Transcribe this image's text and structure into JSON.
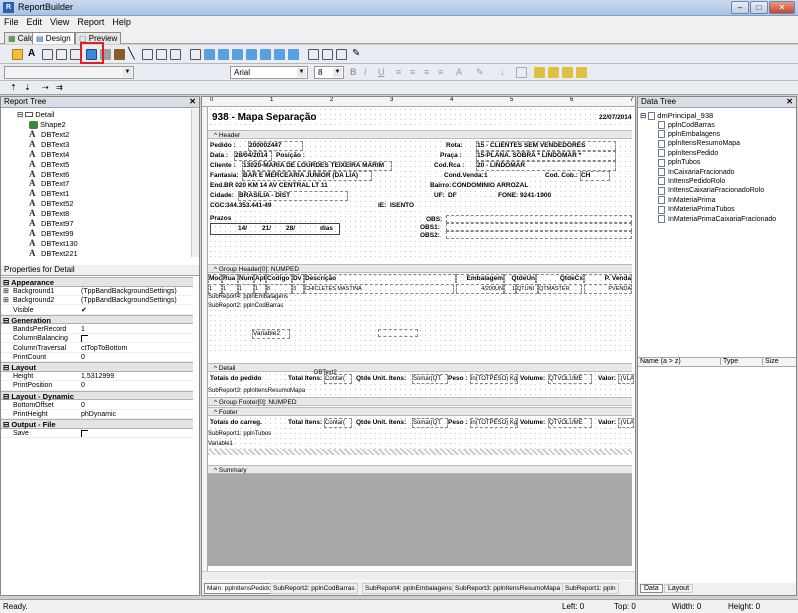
{
  "app": {
    "title": "ReportBuilder"
  },
  "menu": [
    "File",
    "Edit",
    "View",
    "Report",
    "Help"
  ],
  "top_tabs": [
    "Calc",
    "Design",
    "Preview"
  ],
  "font": {
    "name": "Arial",
    "size": "8"
  },
  "report_tree": {
    "title": "Report Tree",
    "root": "Detail",
    "items": [
      "Shape2",
      "DBText2",
      "DBText3",
      "DBText4",
      "DBText5",
      "DBText6",
      "DBText7",
      "DBText1",
      "DBText52",
      "DBText8",
      "DBText97",
      "DBText99",
      "DBText130",
      "DBText221"
    ]
  },
  "properties": {
    "title": "Properties for Detail",
    "sections": [
      {
        "name": "Appearance",
        "rows": [
          {
            "k": "Background1",
            "v": "(TppBandBackgroundSettings)",
            "plus": true
          },
          {
            "k": "Background2",
            "v": "(TppBandBackgroundSettings)",
            "plus": true
          },
          {
            "k": "Visible",
            "v": "",
            "check": true
          }
        ]
      },
      {
        "name": "Generation",
        "rows": [
          {
            "k": "BandsPerRecord",
            "v": "1"
          },
          {
            "k": "ColumnBalancing",
            "v": "",
            "check": false
          },
          {
            "k": "ColumnTraversal",
            "v": "ctTopToBottom"
          },
          {
            "k": "PrintCount",
            "v": "0"
          }
        ]
      },
      {
        "name": "Layout",
        "rows": [
          {
            "k": "Height",
            "v": "1,5312999"
          },
          {
            "k": "PrintPosition",
            "v": "0"
          }
        ]
      },
      {
        "name": "Layout - Dynamic",
        "rows": [
          {
            "k": "BottomOffset",
            "v": "0"
          },
          {
            "k": "PrintHeight",
            "v": "phDynamic"
          }
        ]
      },
      {
        "name": "Output - File",
        "rows": [
          {
            "k": "Save",
            "v": "",
            "check": false
          }
        ]
      }
    ]
  },
  "report": {
    "title": "938 - Mapa Separação",
    "date": "22/07/2014",
    "header_band": "Header",
    "pedido_label": "Pedido :",
    "pedido": "200002447",
    "data_label": "Data :",
    "data": "28/04/2014",
    "posicao_label": "Posição :",
    "cliente_label": "Cliente :",
    "cliente": "13020-MARIA DE LOURDES TEIXEIRA MARIM",
    "fantasia_label": "Fantasia:",
    "fantasia": "BAR E MERCEARIA JUNIOR (DA LIA)",
    "end_label": "End.",
    "endereco": "BR 020 KM 14 AV CENTRAL LT 11",
    "cidade_label": "Cidade:",
    "cidade": "BRASILIA - DIST",
    "cgc_label": "CGC:",
    "cgc": "344.353.441-49",
    "ie_label": "IE:",
    "ie": "ISENTO",
    "rota_label": "Rota:",
    "rota": "15 - CLIENTES SEM VENDEDORES",
    "praca_label": "Praça :",
    "praca": "15-PLANA. SOBRA * LINDOMAR *",
    "codrca_label": "Cod.Rca :",
    "codrca": "20 - LINDOMAR",
    "condvenda_label": "Cond.Venda:",
    "condvenda": "1",
    "codcob_label": "Cod. Cob.:",
    "codcob": "CH",
    "bairro_label": "Bairro:",
    "bairro": "CONDOMINIO ARROZAL",
    "uf_label": "UF:",
    "uf": "DF",
    "fone_label": "FONE:",
    "fone": "9241-1900",
    "prazos_label": "Prazos",
    "prazo1": "14/",
    "prazo2": "21/",
    "prazo3": "28/",
    "dias": "dias",
    "obs_label": "OBS:",
    "obs1_label": "OBS1:",
    "obs2_label": "OBS2:",
    "group_header": "Group Header[0]: NUMPED",
    "columns": [
      "Mod",
      "Rua",
      "Num",
      "Apt",
      "Codigo",
      "Dv",
      "Descrição",
      "Embalagem",
      "QtdeUn",
      "QtdeCx",
      "P. Venda"
    ],
    "row_values": [
      "1",
      "1",
      "1",
      "1",
      "8",
      "3",
      "CHICLETES MASTINA",
      "4/200UN",
      "1",
      "QTUNI",
      "QTMASTER",
      "PVENDA"
    ],
    "subreport4": "SubReport4: pplnEmbalagens",
    "subreport2": "SubReport2: pplnCodBarras",
    "variable2": "Variable2",
    "detail_band": "Detail",
    "totais_pedido": "Totais do pedido",
    "total_itens_label": "Total Itens:",
    "total_itens_val": "Contar(",
    "qtde_unit_label": "Qtde Unit. Itens:",
    "qtde_unit_val": "Somar(QT",
    "peso_label": "Peso :",
    "peso_val": "in(TOTPESO) Kg",
    "volume_label": "Volume:",
    "volume_val": "QTVOLUME",
    "valor_label": "Valor:",
    "valor_val": ":(VLAT",
    "dbtext_label": "DBText2",
    "subreport3": "SubReport3: pplnItensResumoMapa",
    "group_footer": "Group Footer[0]: NUMPED",
    "footer_band": "Footer",
    "totais_carreg": "Totais do carreg.",
    "subreport1": "SubReport1: pplnTubos",
    "variable1": "Variable1",
    "summary_band": "Summary"
  },
  "bottom_tabs": [
    "Main: pplnItensPedido",
    "SubReport2: pplnCodBarras",
    "SubReport4: pplnEmbalagens",
    "SubReport3: pplnItensResumoMapa",
    "SubReport1: ppln"
  ],
  "data_tree": {
    "title": "Data Tree",
    "root": "dmPrincipal_938",
    "items": [
      "pplnCodBarras",
      "pplnEmbalagens",
      "pplnItensResumoMapa",
      "pplnItensPedido",
      "pplnTubos",
      "InCaixariaFracionado",
      "InItensPedidoRolo",
      "InItensCaixariaFracionadoRolo",
      "InMateriaPrima",
      "InMateriaPrimaTubos",
      "InMateriaPrimaCaixariaFracionado"
    ],
    "columns": [
      "Name (a > z)",
      "Type",
      "Size"
    ],
    "tabs": [
      "Data",
      "Layout"
    ]
  },
  "status": {
    "text": "Ready.",
    "left": "Left: 0",
    "top": "Top: 0",
    "width": "Width: 0",
    "height": "Height: 0"
  },
  "ruler": [
    "1",
    "2",
    "3",
    "4",
    "5",
    "6",
    "7"
  ]
}
